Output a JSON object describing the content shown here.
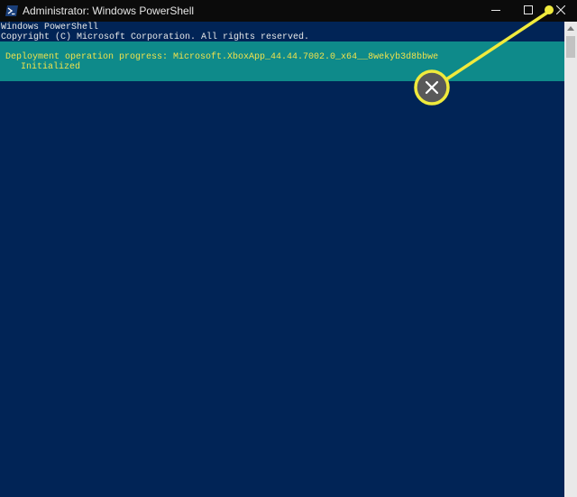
{
  "window": {
    "title": "Administrator: Windows PowerShell",
    "icon": "powershell-icon"
  },
  "controls": {
    "minimize_icon": "minimize-icon",
    "maximize_icon": "maximize-icon",
    "close_icon": "close-icon"
  },
  "console": {
    "lines": [
      "Windows PowerShell",
      "Copyright (C) Microsoft Corporation. All rights reserved."
    ],
    "progress": {
      "title": "Deployment operation progress: Microsoft.XboxApp_44.44.7002.0_x64__8wekyb3d8bbwe",
      "status": "Initialized"
    }
  },
  "annotation": {
    "icon": "close-icon",
    "color": "#f0ea3c"
  },
  "colors": {
    "console_background": "#012456",
    "progress_background": "#0e8a8a",
    "progress_text": "#f0e24c",
    "titlebar": "#0b0b0b"
  }
}
